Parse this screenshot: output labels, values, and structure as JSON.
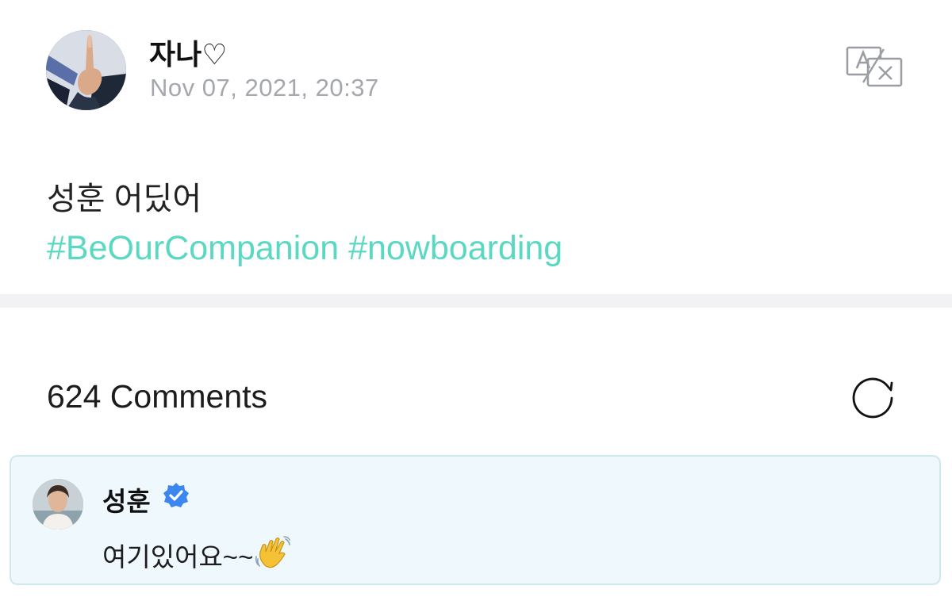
{
  "post": {
    "author": {
      "name": "자나♡",
      "avatar_icon": "pointing-finger-avatar"
    },
    "timestamp": "Nov 07, 2021, 20:37",
    "translate_icon": "translate-icon",
    "body": "성훈 어딨어",
    "hashtags": [
      "#BeOurCompanion",
      "#nowboarding"
    ]
  },
  "comments": {
    "count_label": "624 Comments",
    "refresh_icon": "refresh-icon",
    "pinned": {
      "author": "성훈",
      "verified_icon": "verified-badge-icon",
      "text": "여기있어요~~",
      "emoji_icon": "waving-hand-icon"
    }
  },
  "colors": {
    "hashtag": "#5bd8c2",
    "timestamp": "#a4a7ad",
    "verified": "#3b86f0",
    "comment_background": "#eef8fd",
    "comment_border": "#cfe7ef",
    "divider": "#f2f2f5"
  }
}
